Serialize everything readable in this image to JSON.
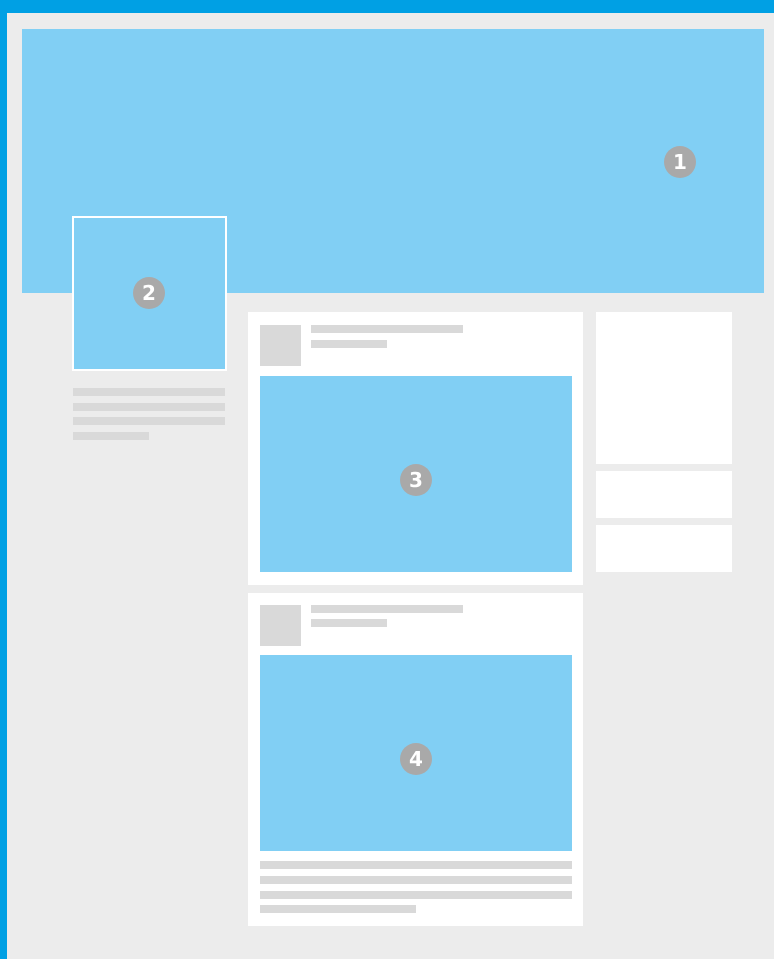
{
  "markers": {
    "cover": "1",
    "profile_picture": "2",
    "post_media_1": "3",
    "post_media_2": "4"
  },
  "colors": {
    "frame": "#00a0e4",
    "background": "#ececec",
    "placeholder_blue": "#81cff4",
    "placeholder_gray": "#d9d9d9",
    "marker": "#a9a9a9"
  }
}
